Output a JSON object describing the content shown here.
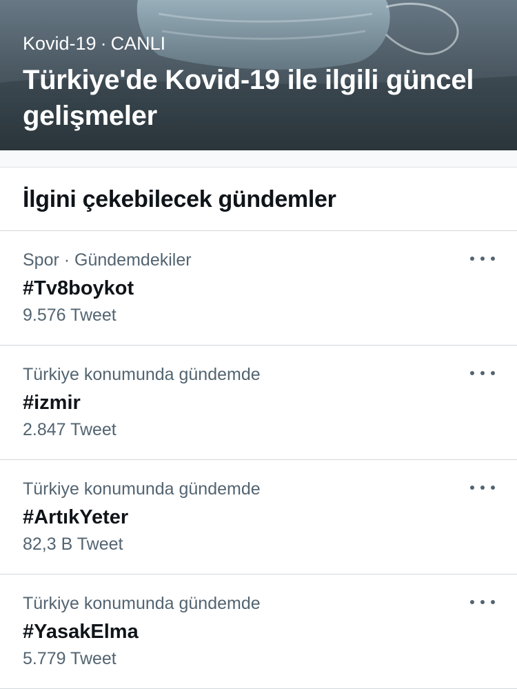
{
  "hero": {
    "topic": "Kovid-19",
    "separator": "·",
    "status": "CANLI",
    "title": "Türkiye'de Kovid-19 ile ilgili güncel gelişmeler"
  },
  "section": {
    "title": "İlgini çekebilecek gündemler"
  },
  "trends": [
    {
      "context": "Spor · Gündemdekiler",
      "name": "#Tv8boykot",
      "count": "9.576 Tweet"
    },
    {
      "context": "Türkiye konumunda gündemde",
      "name": "#izmir",
      "count": "2.847 Tweet"
    },
    {
      "context": "Türkiye konumunda gündemde",
      "name": "#ArtıkYeter",
      "count": "82,3 B Tweet"
    },
    {
      "context": "Türkiye konumunda gündemde",
      "name": "#YasakElma",
      "count": "5.779 Tweet"
    }
  ],
  "icons": {
    "more": "more-horizontal-icon"
  }
}
